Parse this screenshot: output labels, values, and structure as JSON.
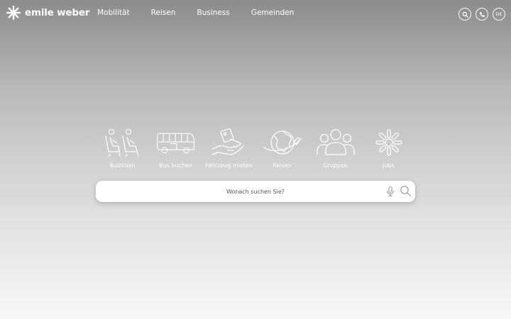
{
  "brand": {
    "name": "emile weber",
    "logo_icon": "snowflake-logo-icon"
  },
  "nav": {
    "items": [
      {
        "label": "Mobilität"
      },
      {
        "label": "Reisen"
      },
      {
        "label": "Business"
      },
      {
        "label": "Gemeinden"
      }
    ]
  },
  "header_actions": {
    "search_icon": "search-icon",
    "phone_icon": "phone-icon",
    "language": "DE"
  },
  "services": [
    {
      "label": "Buslinien",
      "icon": "bus-seats-icon"
    },
    {
      "label": "Bus buchen",
      "icon": "bus-icon"
    },
    {
      "label": "Fahrzeug mieten",
      "icon": "key-in-hand-icon"
    },
    {
      "label": "Reisen",
      "icon": "globe-plane-icon"
    },
    {
      "label": "Gruppen",
      "icon": "group-icon"
    },
    {
      "label": "Jobs",
      "icon": "snowflake-icon"
    }
  ],
  "search": {
    "placeholder": "Wonach suchen Sie?",
    "value": "",
    "mic_icon": "microphone-icon",
    "search_icon": "search-icon"
  },
  "colors": {
    "background_top": "#8c8c8c",
    "background_bottom": "#f7f7f7",
    "foreground": "#ffffff",
    "search_text": "#555555"
  }
}
